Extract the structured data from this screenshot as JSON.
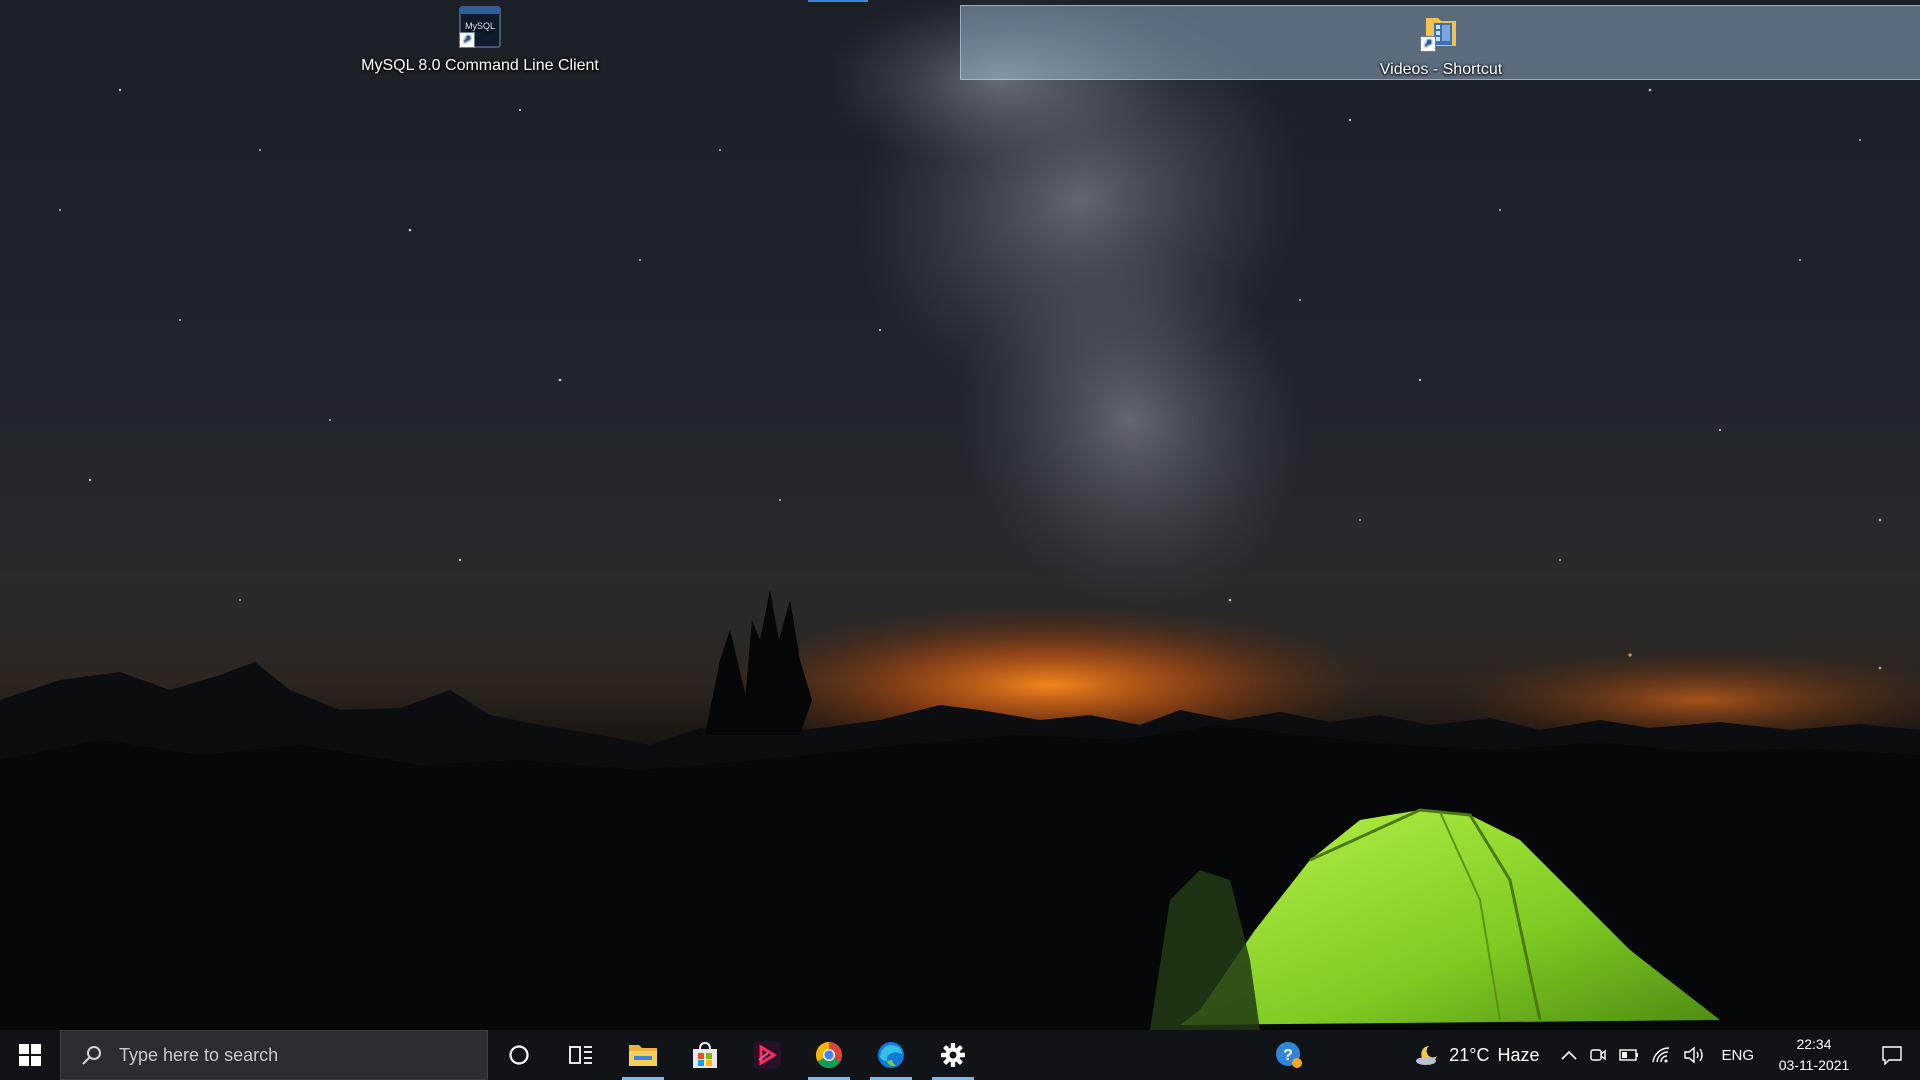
{
  "desktop": {
    "icons": [
      {
        "label": "MySQL 8.0 Command Line Client",
        "icon": "mysql-icon",
        "badge_text": "MySQL"
      },
      {
        "label": "Videos - Shortcut",
        "icon": "videos-folder-icon",
        "selected": true
      }
    ]
  },
  "taskbar": {
    "search": {
      "placeholder": "Type here to search"
    },
    "pinned": [
      {
        "name": "Cortana",
        "icon": "cortana-icon"
      },
      {
        "name": "Task View",
        "icon": "task-view-icon"
      },
      {
        "name": "File Explorer",
        "icon": "file-explorer-icon",
        "active": true
      },
      {
        "name": "Microsoft Store",
        "icon": "store-icon"
      },
      {
        "name": "Media App",
        "icon": "media-app-icon"
      },
      {
        "name": "Google Chrome",
        "icon": "chrome-icon",
        "active": true
      },
      {
        "name": "Microsoft Edge",
        "icon": "edge-icon",
        "active": true
      },
      {
        "name": "Settings",
        "icon": "settings-icon",
        "active": true
      }
    ],
    "weather": {
      "temp": "21°C",
      "condition": "Haze",
      "icon": "moon-cloud-icon"
    },
    "tray": {
      "language": "ENG"
    },
    "clock": {
      "time": "22:34",
      "date": "03-11-2021"
    }
  },
  "colors": {
    "taskbar_bg": "#101418",
    "active_indicator": "#76b9ed",
    "selection": "#aac8e6"
  }
}
